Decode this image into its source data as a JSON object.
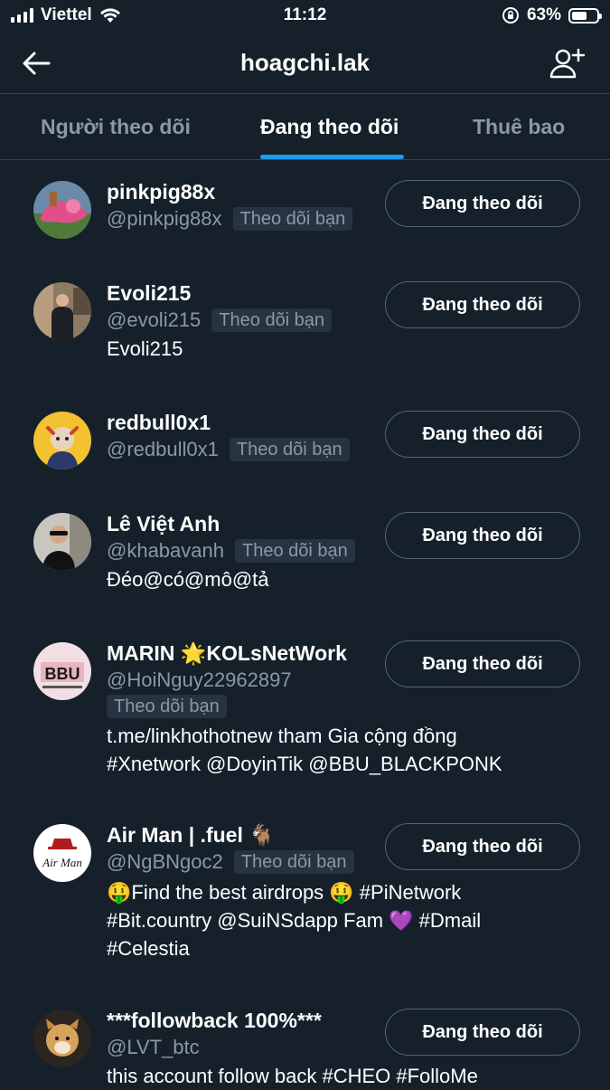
{
  "status_bar": {
    "carrier": "Viettel",
    "time": "11:12",
    "battery": "63%",
    "battery_level": 0.63,
    "icons": [
      "signal-icon",
      "wifi-icon",
      "rotation-lock-icon",
      "battery-icon"
    ]
  },
  "header": {
    "title": "hoagchi.lak",
    "back_icon": "arrow-left-icon",
    "add_icon": "add-user-icon"
  },
  "tabs": [
    {
      "label": "Người theo dõi",
      "active": false
    },
    {
      "label": "Đang theo dõi",
      "active": true
    },
    {
      "label": "Thuê bao",
      "active": false
    }
  ],
  "colors": {
    "background": "#15202b",
    "accent": "#1d9bf0",
    "secondary_text": "#8b98a5"
  },
  "users": [
    {
      "name": "pinkpig88x",
      "handle": "@pinkpig88x",
      "badge": "Theo dõi bạn",
      "bio_lines": [],
      "button": "Đang theo dõi"
    },
    {
      "name": "Evoli215",
      "handle": "@evoli215",
      "badge": "Theo dõi bạn",
      "bio_lines": [
        "Evoli215"
      ],
      "button": "Đang theo dõi"
    },
    {
      "name": "redbull0x1",
      "handle": "@redbull0x1",
      "badge": "Theo dõi bạn",
      "bio_lines": [],
      "button": "Đang theo dõi"
    },
    {
      "name": "Lê Việt Anh",
      "handle": "@khabavanh",
      "badge": "Theo dõi bạn",
      "bio_lines": [
        "Đéo@có@mô@tả"
      ],
      "button": "Đang theo dõi"
    },
    {
      "name": "MARIN 🌟KOLsNetWork",
      "handle": "@HoiNguy22962897",
      "badge": "Theo dõi bạn",
      "bio_lines": [
        "t.me/linkhothotnew tham Gia cộng đồng",
        "#Xnetwork @DoyinTik @BBU_BLACKPONK"
      ],
      "button": "Đang theo dõi"
    },
    {
      "name": "Air Man | .fuel 🐐",
      "handle": "@NgBNgoc2",
      "badge": "Theo dõi bạn",
      "bio_lines": [
        "🤑Find the best airdrops 🤑 #PiNetwork",
        "#Bit.country @SuiNSdapp Fam 💜 #Dmail",
        "#Celestia"
      ],
      "button": "Đang theo dõi"
    },
    {
      "name": "***followback 100%***",
      "handle": "@LVT_btc",
      "badge": "",
      "bio_lines": [
        "this account follow back #CHEO #FolloMe"
      ],
      "button": "Đang theo dõi"
    }
  ]
}
